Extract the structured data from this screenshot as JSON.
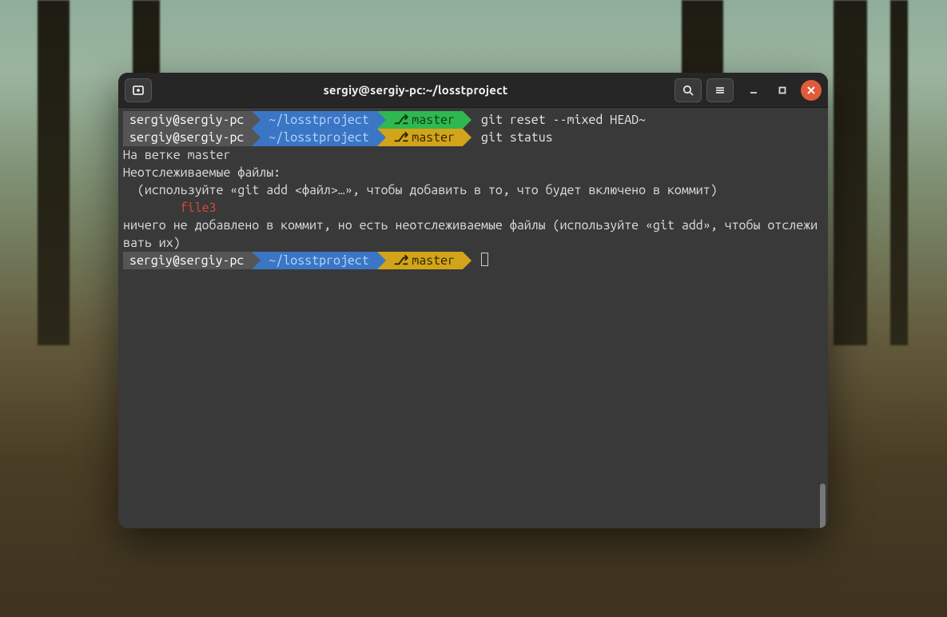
{
  "window": {
    "title": "sergiy@sergiy-pc:~/losstproject"
  },
  "prompt": {
    "user": "sergiy@sergiy-pc",
    "path": "~/losstproject",
    "branch": "master",
    "branch_symbol": "⎇"
  },
  "lines": [
    {
      "type": "prompt",
      "branch_state": "clean",
      "command": "git reset --mixed HEAD~"
    },
    {
      "type": "prompt",
      "branch_state": "dirty",
      "command": "git status"
    }
  ],
  "status_output": {
    "l1": "На ветке master",
    "l2": "Неотслеживаемые файлы:",
    "l3": "  (используйте «git add <файл>…», чтобы добавить в то, что будет включено в коммит)",
    "file_indent": "        ",
    "file": "file3",
    "blank": "",
    "l4": "ничего не добавлено в коммит, но есть неотслеживаемые файлы (используйте «git add», чтобы отслеживать их)"
  },
  "final_prompt": {
    "branch_state": "dirty"
  },
  "icons": {
    "newtab": "new-tab-icon",
    "search": "search-icon",
    "menu": "hamburger-icon",
    "minimize": "minimize-icon",
    "maximize": "maximize-icon",
    "close": "close-icon"
  }
}
